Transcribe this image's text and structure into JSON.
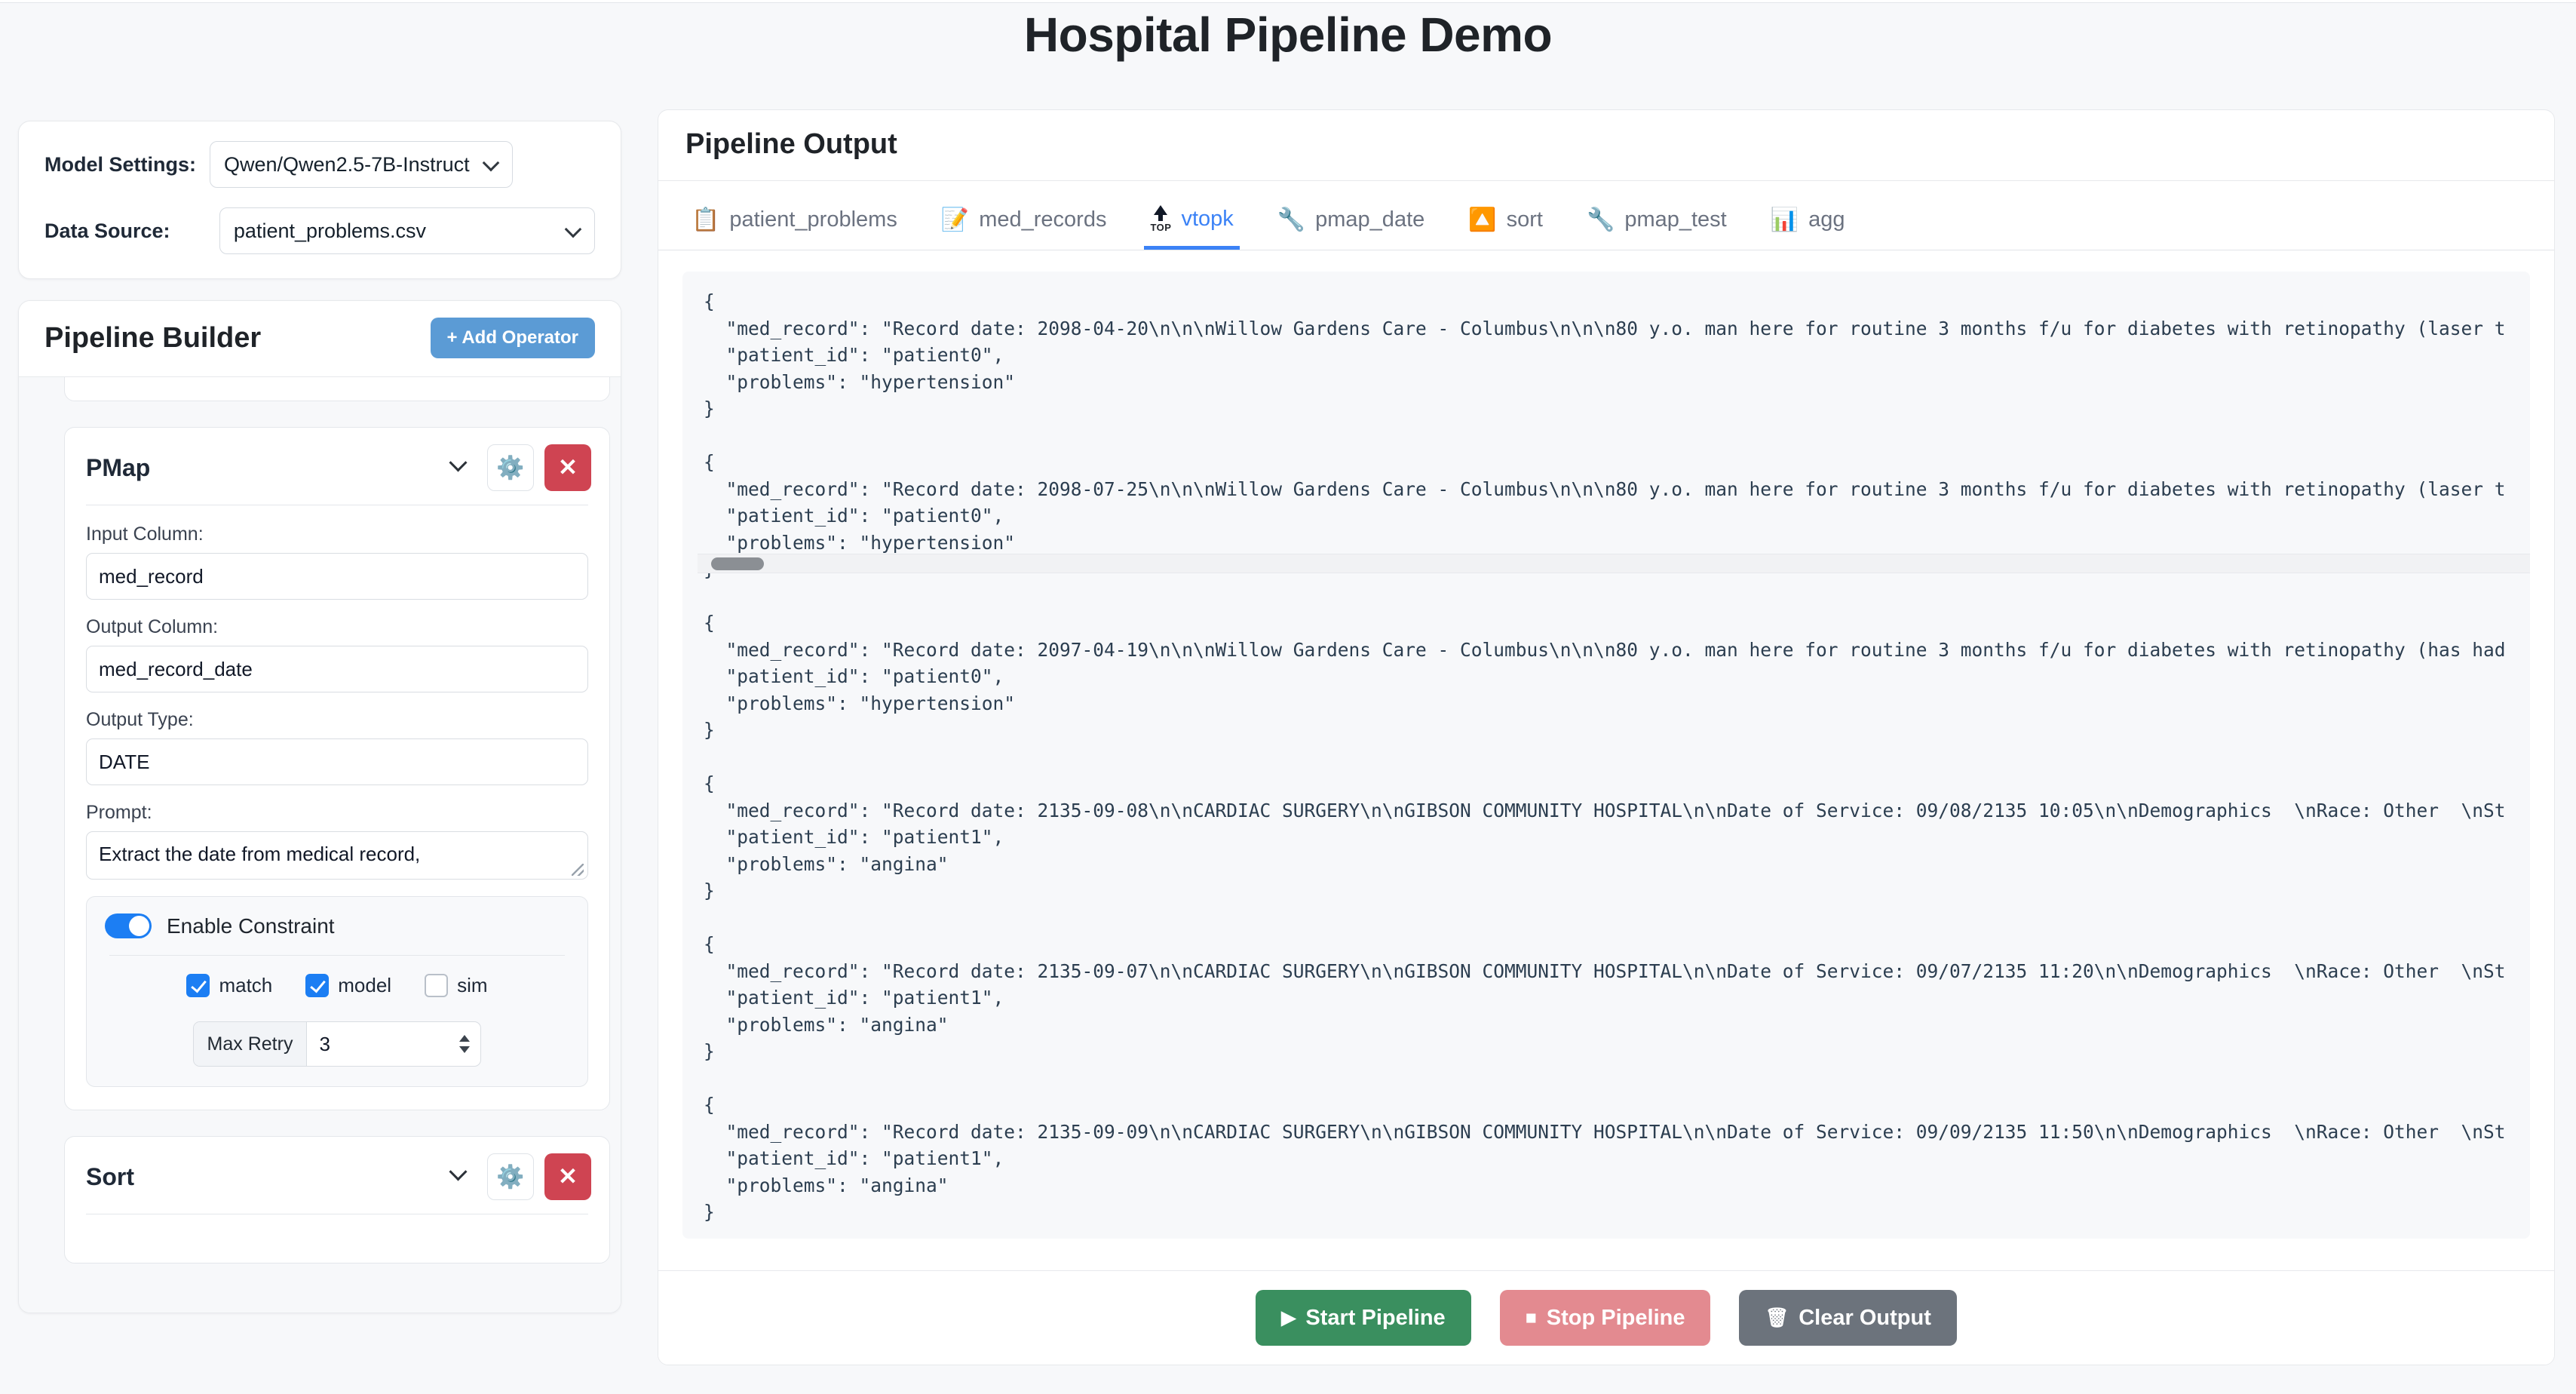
{
  "app": {
    "title": "Hospital Pipeline Demo"
  },
  "settings": {
    "model_label": "Model Settings:",
    "model_value": "Qwen/Qwen2.5-7B-Instruct",
    "data_source_label": "Data Source:",
    "data_source_value": "patient_problems.csv"
  },
  "builder": {
    "title": "Pipeline Builder",
    "add_operator_label": "+ Add Operator",
    "operators": [
      {
        "name": "PMap",
        "settings_icon": "gear-icon",
        "delete_label": "✕",
        "fields": [
          {
            "label": "Input Column:",
            "value": "med_record"
          },
          {
            "label": "Output Column:",
            "value": "med_record_date"
          },
          {
            "label": "Output Type:",
            "value": "DATE"
          }
        ],
        "prompt_label": "Prompt:",
        "prompt_value": "Extract the date from medical record,",
        "constraint": {
          "toggle_label": "Enable Constraint",
          "enabled": true,
          "checks": [
            {
              "label": "match",
              "checked": true
            },
            {
              "label": "model",
              "checked": true
            },
            {
              "label": "sim",
              "checked": false
            }
          ],
          "retry_label": "Max Retry",
          "retry_value": "3"
        }
      },
      {
        "name": "Sort",
        "settings_icon": "gear-icon",
        "delete_label": "✕"
      }
    ]
  },
  "output": {
    "title": "Pipeline Output",
    "tabs": [
      {
        "label": "patient_problems",
        "icon": "📋",
        "icon_name": "clipboard-icon",
        "active": false
      },
      {
        "label": "med_records",
        "icon": "📝",
        "icon_name": "memo-icon",
        "active": false
      },
      {
        "label": "vtopk",
        "icon": "TOP",
        "icon_name": "top-arrow-icon",
        "active": true
      },
      {
        "label": "pmap_date",
        "icon": "🔧",
        "icon_name": "wrench-icon",
        "active": false
      },
      {
        "label": "sort",
        "icon": "↕",
        "icon_name": "updown-arrow-button-icon",
        "active": false
      },
      {
        "label": "pmap_test",
        "icon": "🔧",
        "icon_name": "wrench-icon",
        "active": false
      },
      {
        "label": "agg",
        "icon": "📊",
        "icon_name": "bar-chart-icon",
        "active": false
      }
    ],
    "records_text": "{\n  \"med_record\": \"Record date: 2098-04-20\\n\\n\\nWillow Gardens Care - Columbus\\n\\n\\n80 y.o. man here for routine 3 months f/u for diabetes with retinopathy (laser t\n  \"patient_id\": \"patient0\",\n  \"problems\": \"hypertension\"\n}\n\n{\n  \"med_record\": \"Record date: 2098-07-25\\n\\n\\nWillow Gardens Care - Columbus\\n\\n\\n80 y.o. man here for routine 3 months f/u for diabetes with retinopathy (laser t\n  \"patient_id\": \"patient0\",\n  \"problems\": \"hypertension\"\n}\n\n{\n  \"med_record\": \"Record date: 2097-04-19\\n\\n\\nWillow Gardens Care - Columbus\\n\\n\\n80 y.o. man here for routine 3 months f/u for diabetes with retinopathy (has had\n  \"patient_id\": \"patient0\",\n  \"problems\": \"hypertension\"\n}\n\n{\n  \"med_record\": \"Record date: 2135-09-08\\n\\nCARDIAC SURGERY\\n\\nGIBSON COMMUNITY HOSPITAL\\n\\nDate of Service: 09/08/2135 10:05\\n\\nDemographics  \\nRace: Other  \\nSt\n  \"patient_id\": \"patient1\",\n  \"problems\": \"angina\"\n}\n\n{\n  \"med_record\": \"Record date: 2135-09-07\\n\\nCARDIAC SURGERY\\n\\nGIBSON COMMUNITY HOSPITAL\\n\\nDate of Service: 09/07/2135 11:20\\n\\nDemographics  \\nRace: Other  \\nSt\n  \"patient_id\": \"patient1\",\n  \"problems\": \"angina\"\n}\n\n{\n  \"med_record\": \"Record date: 2135-09-09\\n\\nCARDIAC SURGERY\\n\\nGIBSON COMMUNITY HOSPITAL\\n\\nDate of Service: 09/09/2135 11:50\\n\\nDemographics  \\nRace: Other  \\nSt\n  \"patient_id\": \"patient1\",\n  \"problems\": \"angina\"\n}",
    "actions": [
      {
        "label": "Start Pipeline",
        "glyph": "▶",
        "kind": "start"
      },
      {
        "label": "Stop Pipeline",
        "glyph": "■",
        "kind": "stop"
      },
      {
        "label": "Clear Output",
        "glyph": "🗑",
        "kind": "clear"
      }
    ]
  },
  "colors": {
    "accent_blue": "#3b82f6",
    "add_button_blue": "#5b9bd5",
    "delete_red": "#cf4452",
    "start_green": "#3a8f5f",
    "stop_red": "#e38a90",
    "clear_gray": "#6c737c",
    "toggle_blue": "#1c7ef3"
  }
}
